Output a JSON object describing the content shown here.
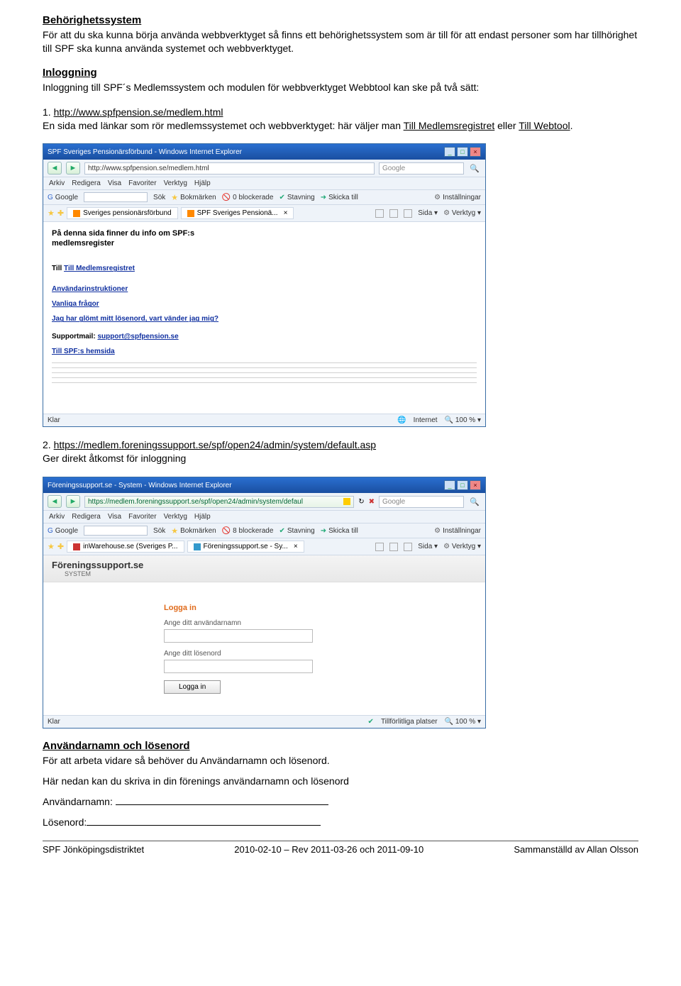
{
  "doc": {
    "h1": "Behörighetssystem",
    "p1": "För att du ska kunna börja använda webbverktyget så finns ett behörighetssystem som är till för att endast personer som har tillhörighet till SPF ska kunna använda systemet och webbverktyget.",
    "h2": "Inloggning",
    "p2": "Inloggning till SPF´s Medlemssystem och modulen för webbverktyget Webbtool kan ske på två sätt:",
    "item1num": "1. ",
    "item1url": "http://www.spfpension.se/medlem.html",
    "item1a": "En sida med länkar som rör medlemssystemet och webbverktyget: här väljer man ",
    "item1link1": "Till Medlemsregistret",
    "item1mid": " eller ",
    "item1link2": "Till Webtool",
    "item1end": ".",
    "item2num": "2. ",
    "item2url": "https://medlem.foreningssupport.se/spf/open24/admin/system/default.asp",
    "item2txt": "Ger direkt åtkomst för inloggning",
    "h3": "Användarnamn och lösenord",
    "p3": "För att arbeta vidare så behöver du Användarnamn och lösenord.",
    "p4": "Här nedan kan du skriva in din förenings användarnamn och lösenord",
    "un_label": "Användarnamn:",
    "pw_label": "Lösenord:"
  },
  "browser1": {
    "title": "SPF Sveriges Pensionärsförbund - Windows Internet Explorer",
    "url": "http://www.spfpension.se/medlem.html",
    "google_placeholder": "Google",
    "menu_arkiv": "Arkiv",
    "menu_redigera": "Redigera",
    "menu_visa": "Visa",
    "menu_favoriter": "Favoriter",
    "menu_verktyg": "Verktyg",
    "menu_hjalp": "Hjälp",
    "tb_google": "Google",
    "tb_sok": "Sök",
    "tb_bokmarken": "Bokmärken",
    "tb_blockerade": "0 blockerade",
    "tb_stavning": "Stavning",
    "tb_skicka": "Skicka till",
    "tb_install": "Inställningar",
    "tab1": "Sveriges pensionärsförbund",
    "tab2": "SPF Sveriges Pensionä...",
    "rb_sida": "Sida",
    "rb_verktyg": "Verktyg",
    "c_head1": "På denna sida finner du info om SPF:s",
    "c_head2": "medlemsregister",
    "l_medlem": "Till Medlemsregistret",
    "l_anv": "Användarinstruktioner",
    "l_faq": "Vanliga frågor",
    "l_glomt": "Jag har glömt mitt lösenord, vart vänder jag mig?",
    "l_support_pre": "Supportmail: ",
    "l_support_link": "support@spfpension.se",
    "l_hem": "Till SPF:s hemsida",
    "status_klar": "Klar",
    "status_internet": "Internet",
    "status_zoom": "100 %"
  },
  "browser2": {
    "title": "Föreningssupport.se - System - Windows Internet Explorer",
    "url": "https://medlem.foreningssupport.se/spf/open24/admin/system/defaul",
    "google_placeholder": "Google",
    "menu_arkiv": "Arkiv",
    "menu_redigera": "Redigera",
    "menu_visa": "Visa",
    "menu_favoriter": "Favoriter",
    "menu_verktyg": "Verktyg",
    "menu_hjalp": "Hjälp",
    "tb_google": "Google",
    "tb_sok": "Sök",
    "tb_bokmarken": "Bokmärken",
    "tb_blockerade": "8 blockerade",
    "tb_stavning": "Stavning",
    "tb_skicka": "Skicka till",
    "tb_install": "Inställningar",
    "tab1": "inWarehouse.se (Sveriges P...",
    "tab2": "Föreningssupport.se - Sy...",
    "rb_sida": "Sida",
    "rb_verktyg": "Verktyg",
    "brand": "Föreningssupport.se",
    "brand_sub": "SYSTEM",
    "login_head": "Logga in",
    "un_lbl": "Ange ditt användarnamn",
    "pw_lbl": "Ange ditt lösenord",
    "login_btn": "Logga in",
    "status_klar": "Klar",
    "status_trusted": "Tillförlitliga platser",
    "status_zoom": "100 %"
  },
  "footer": {
    "left": "SPF Jönköpingsdistriktet",
    "center": "2010-02-10 – Rev 2011-03-26 och 2011-09-10",
    "right": "Sammanställd av Allan Olsson"
  }
}
